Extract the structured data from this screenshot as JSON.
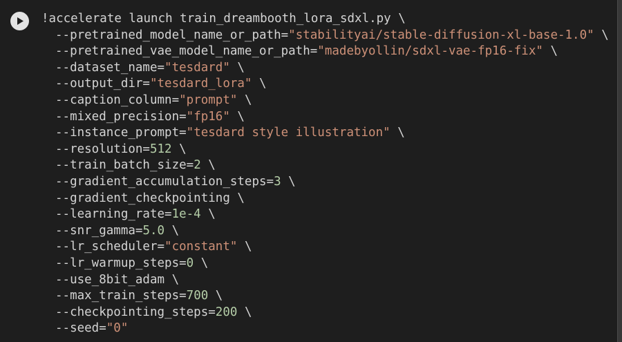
{
  "run_button": {
    "icon": "play-icon"
  },
  "colors": {
    "background": "#1e1e1e",
    "text": "#d4d4d4",
    "string": "#ce9178",
    "number": "#b5cea8"
  },
  "code": {
    "command": "!accelerate launch train_dreambooth_lora_sdxl.py \\",
    "args": [
      {
        "flag": "--pretrained_model_name_or_path=",
        "value": "\"stabilityai/stable-diffusion-xl-base-1.0\"",
        "kind": "string"
      },
      {
        "flag": "--pretrained_vae_model_name_or_path=",
        "value": "\"madebyollin/sdxl-vae-fp16-fix\"",
        "kind": "string"
      },
      {
        "flag": "--dataset_name=",
        "value": "\"tesdard\"",
        "kind": "string"
      },
      {
        "flag": "--output_dir=",
        "value": "\"tesdard_lora\"",
        "kind": "string"
      },
      {
        "flag": "--caption_column=",
        "value": "\"prompt\"",
        "kind": "string"
      },
      {
        "flag": "--mixed_precision=",
        "value": "\"fp16\"",
        "kind": "string"
      },
      {
        "flag": "--instance_prompt=",
        "value": "\"tesdard style illustration\"",
        "kind": "string"
      },
      {
        "flag": "--resolution=",
        "value": "512",
        "kind": "number"
      },
      {
        "flag": "--train_batch_size=",
        "value": "2",
        "kind": "number"
      },
      {
        "flag": "--gradient_accumulation_steps=",
        "value": "3",
        "kind": "number"
      },
      {
        "flag": "--gradient_checkpointing",
        "value": "",
        "kind": "none"
      },
      {
        "flag": "--learning_rate=",
        "value": "1e-4",
        "kind": "number"
      },
      {
        "flag": "--snr_gamma=",
        "value": "5.0",
        "kind": "number"
      },
      {
        "flag": "--lr_scheduler=",
        "value": "\"constant\"",
        "kind": "string"
      },
      {
        "flag": "--lr_warmup_steps=",
        "value": "0",
        "kind": "number"
      },
      {
        "flag": "--use_8bit_adam",
        "value": "",
        "kind": "none"
      },
      {
        "flag": "--max_train_steps=",
        "value": "700",
        "kind": "number"
      },
      {
        "flag": "--checkpointing_steps=",
        "value": "200",
        "kind": "number"
      },
      {
        "flag": "--seed=",
        "value": "\"0\"",
        "kind": "string",
        "last": true
      }
    ]
  }
}
